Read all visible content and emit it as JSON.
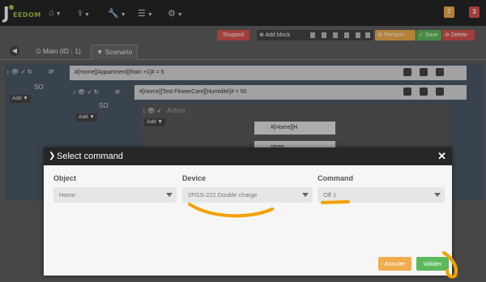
{
  "navbar": {
    "logo_text": "EEDOM",
    "logo_letter": "J",
    "menus": [
      "home-menu",
      "health-menu",
      "tools-menu",
      "list-menu",
      "settings-menu"
    ],
    "badge_orange": "7",
    "badge_red": "3"
  },
  "toolbar": {
    "stopped_label": "Stopped",
    "add_block_label": "Add block",
    "perform_label": "Perform",
    "save_label": "Save",
    "delete_label": "Delete"
  },
  "tabs": {
    "main_label": "Main (ID : 1)",
    "scenario_label": "Scenario"
  },
  "scenario": {
    "if_label": "IF",
    "so_label": "SO",
    "add_label": "Add",
    "condition_1": "#[Home][Appartment][Rain +1]# = 5",
    "condition_2": "#[Home][Test FlowerCare][Humidité]# < 50",
    "action_label": "Action",
    "cmd_1": "#[Home][H",
    "cmd_2": "sleep"
  },
  "modal": {
    "title": "Select command",
    "object_label": "Object",
    "object_value": "Home",
    "device_label": "Device",
    "device_value": "2FGS-222 Double charge",
    "command_label": "Command",
    "command_value": "Off 1",
    "cancel_label": "Annuler",
    "validate_label": "Valider"
  },
  "colors": {
    "navbar": "#262626",
    "success": "#5cb85c",
    "warning": "#f0ad4e",
    "danger": "#d9534f",
    "annotation": "#f5a100"
  }
}
